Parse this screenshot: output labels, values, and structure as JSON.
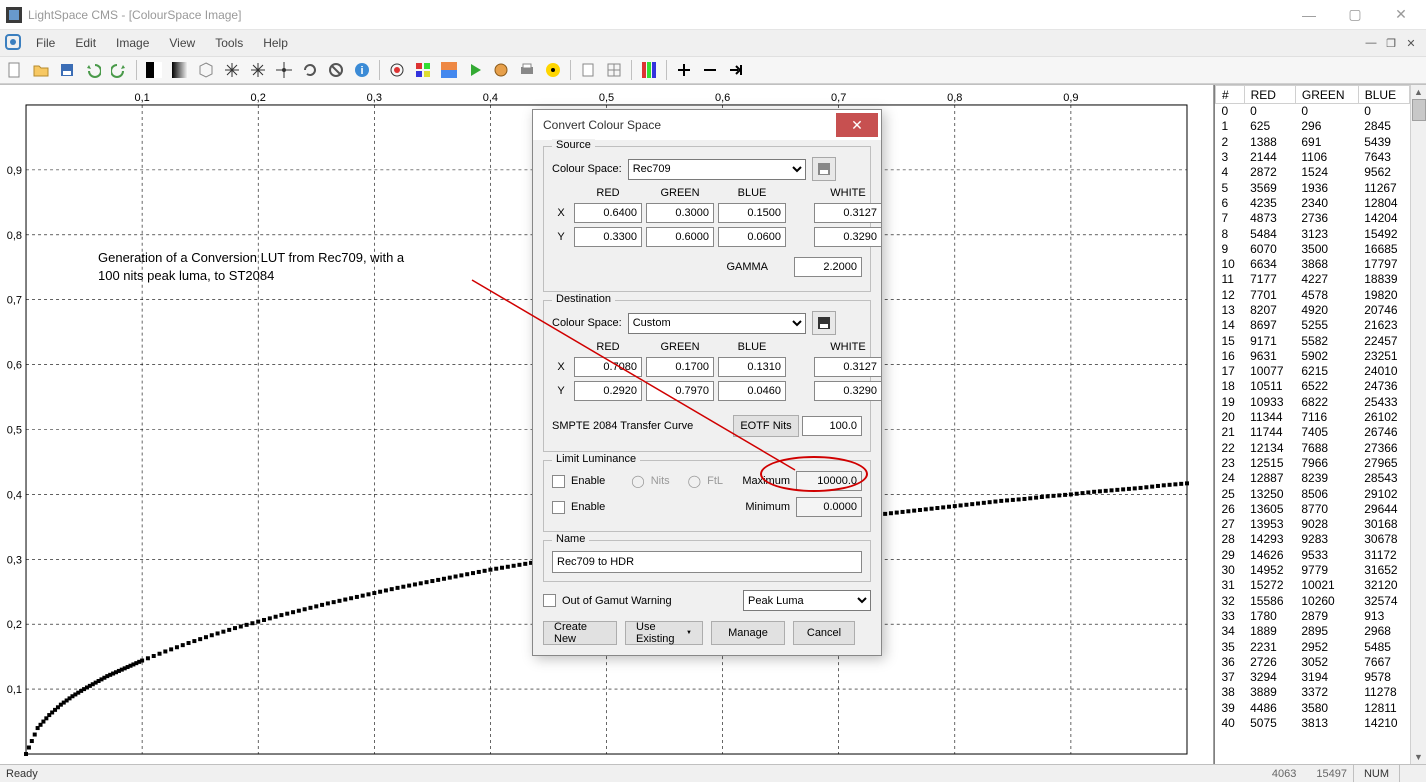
{
  "window": {
    "title": "LightSpace CMS - [ColourSpace Image]"
  },
  "menu": {
    "items": [
      "File",
      "Edit",
      "Image",
      "View",
      "Tools",
      "Help"
    ]
  },
  "statusbar": {
    "ready": "Ready",
    "footer_num": "4063",
    "footer_num2": "15497",
    "indicator": "NUM"
  },
  "dialog": {
    "title": "Convert Colour Space",
    "source_legend": "Source",
    "dest_legend": "Destination",
    "limit_legend": "Limit Luminance",
    "name_legend": "Name",
    "colour_space_label": "Colour Space:",
    "source_space": "Rec709",
    "dest_space": "Custom",
    "col_red": "RED",
    "col_green": "GREEN",
    "col_blue": "BLUE",
    "col_white": "WHITE",
    "row_x": "X",
    "row_y": "Y",
    "gamma_label": "GAMMA",
    "source": {
      "red_x": "0.6400",
      "green_x": "0.3000",
      "blue_x": "0.1500",
      "white_x": "0.3127",
      "red_y": "0.3300",
      "green_y": "0.6000",
      "blue_y": "0.0600",
      "white_y": "0.3290",
      "gamma": "2.2000"
    },
    "dest": {
      "red_x": "0.7080",
      "green_x": "0.1700",
      "blue_x": "0.1310",
      "white_x": "0.3127",
      "red_y": "0.2920",
      "green_y": "0.7970",
      "blue_y": "0.0460",
      "white_y": "0.3290"
    },
    "transfer_curve_label": "SMPTE 2084 Transfer Curve",
    "eotf_label": "EOTF Nits",
    "eotf_value": "100.0",
    "enable_label": "Enable",
    "nits_label": "Nits",
    "ftl_label": "FtL",
    "max_label": "Maximum",
    "min_label": "Minimum",
    "max_value": "10000.0",
    "min_value": "0.0000",
    "name_value": "Rec709 to HDR",
    "out_of_gamut_label": "Out of Gamut Warning",
    "gamut_select": "Peak Luma",
    "btn_create": "Create New",
    "btn_use_existing": "Use Existing",
    "btn_manage": "Manage",
    "btn_cancel": "Cancel"
  },
  "annotation": {
    "line1": "Generation of a Conversion LUT from Rec709, with a",
    "line2": "100 nits peak luma, to ST2084"
  },
  "axis_x": [
    "0,1",
    "0,2",
    "0,3",
    "0,4",
    "0,5",
    "0,6",
    "0,7",
    "0,8",
    "0,9"
  ],
  "axis_y": [
    "0,1",
    "0,2",
    "0,3",
    "0,4",
    "0,5",
    "0,6",
    "0,7",
    "0,8",
    "0,9"
  ],
  "data_table": {
    "headers": [
      "#",
      "RED",
      "GREEN",
      "BLUE"
    ],
    "rows": [
      [
        "0",
        "0",
        "0",
        "0"
      ],
      [
        "1",
        "625",
        "296",
        "2845"
      ],
      [
        "2",
        "1388",
        "691",
        "5439"
      ],
      [
        "3",
        "2144",
        "1106",
        "7643"
      ],
      [
        "4",
        "2872",
        "1524",
        "9562"
      ],
      [
        "5",
        "3569",
        "1936",
        "11267"
      ],
      [
        "6",
        "4235",
        "2340",
        "12804"
      ],
      [
        "7",
        "4873",
        "2736",
        "14204"
      ],
      [
        "8",
        "5484",
        "3123",
        "15492"
      ],
      [
        "9",
        "6070",
        "3500",
        "16685"
      ],
      [
        "10",
        "6634",
        "3868",
        "17797"
      ],
      [
        "11",
        "7177",
        "4227",
        "18839"
      ],
      [
        "12",
        "7701",
        "4578",
        "19820"
      ],
      [
        "13",
        "8207",
        "4920",
        "20746"
      ],
      [
        "14",
        "8697",
        "5255",
        "21623"
      ],
      [
        "15",
        "9171",
        "5582",
        "22457"
      ],
      [
        "16",
        "9631",
        "5902",
        "23251"
      ],
      [
        "17",
        "10077",
        "6215",
        "24010"
      ],
      [
        "18",
        "10511",
        "6522",
        "24736"
      ],
      [
        "19",
        "10933",
        "6822",
        "25433"
      ],
      [
        "20",
        "11344",
        "7116",
        "26102"
      ],
      [
        "21",
        "11744",
        "7405",
        "26746"
      ],
      [
        "22",
        "12134",
        "7688",
        "27366"
      ],
      [
        "23",
        "12515",
        "7966",
        "27965"
      ],
      [
        "24",
        "12887",
        "8239",
        "28543"
      ],
      [
        "25",
        "13250",
        "8506",
        "29102"
      ],
      [
        "26",
        "13605",
        "8770",
        "29644"
      ],
      [
        "27",
        "13953",
        "9028",
        "30168"
      ],
      [
        "28",
        "14293",
        "9283",
        "30678"
      ],
      [
        "29",
        "14626",
        "9533",
        "31172"
      ],
      [
        "30",
        "14952",
        "9779",
        "31652"
      ],
      [
        "31",
        "15272",
        "10021",
        "32120"
      ],
      [
        "32",
        "15586",
        "10260",
        "32574"
      ],
      [
        "33",
        "1780",
        "2879",
        "913"
      ],
      [
        "34",
        "1889",
        "2895",
        "2968"
      ],
      [
        "35",
        "2231",
        "2952",
        "5485"
      ],
      [
        "36",
        "2726",
        "3052",
        "7667"
      ],
      [
        "37",
        "3294",
        "3194",
        "9578"
      ],
      [
        "38",
        "3889",
        "3372",
        "11278"
      ],
      [
        "39",
        "4486",
        "3580",
        "12811"
      ],
      [
        "40",
        "5075",
        "3813",
        "14210"
      ]
    ]
  },
  "chart_data": {
    "type": "scatter",
    "title": "",
    "xlabel": "",
    "ylabel": "",
    "xlim": [
      0,
      1
    ],
    "ylim": [
      0,
      1
    ],
    "x_ticks": [
      0.1,
      0.2,
      0.3,
      0.4,
      0.5,
      0.6,
      0.7,
      0.8,
      0.9
    ],
    "y_ticks": [
      0.1,
      0.2,
      0.3,
      0.4,
      0.5,
      0.6,
      0.7,
      0.8,
      0.9
    ],
    "series": [
      {
        "name": "Transfer Curve",
        "points": [
          [
            0.0,
            0.0
          ],
          [
            0.01,
            0.04
          ],
          [
            0.02,
            0.06
          ],
          [
            0.03,
            0.076
          ],
          [
            0.04,
            0.089
          ],
          [
            0.05,
            0.1
          ],
          [
            0.06,
            0.11
          ],
          [
            0.07,
            0.12
          ],
          [
            0.08,
            0.128
          ],
          [
            0.09,
            0.136
          ],
          [
            0.1,
            0.144
          ],
          [
            0.12,
            0.158
          ],
          [
            0.14,
            0.171
          ],
          [
            0.16,
            0.183
          ],
          [
            0.18,
            0.194
          ],
          [
            0.2,
            0.204
          ],
          [
            0.22,
            0.214
          ],
          [
            0.24,
            0.223
          ],
          [
            0.26,
            0.232
          ],
          [
            0.28,
            0.24
          ],
          [
            0.3,
            0.248
          ],
          [
            0.32,
            0.256
          ],
          [
            0.34,
            0.263
          ],
          [
            0.36,
            0.27
          ],
          [
            0.38,
            0.277
          ],
          [
            0.4,
            0.284
          ],
          [
            0.42,
            0.29
          ],
          [
            0.44,
            0.296
          ],
          [
            0.46,
            0.302
          ],
          [
            0.48,
            0.308
          ],
          [
            0.5,
            0.313
          ],
          [
            0.52,
            0.319
          ],
          [
            0.54,
            0.324
          ],
          [
            0.56,
            0.329
          ],
          [
            0.58,
            0.334
          ],
          [
            0.6,
            0.339
          ],
          [
            0.62,
            0.344
          ],
          [
            0.64,
            0.349
          ],
          [
            0.66,
            0.353
          ],
          [
            0.68,
            0.358
          ],
          [
            0.7,
            0.362
          ],
          [
            0.72,
            0.366
          ],
          [
            0.74,
            0.37
          ],
          [
            0.76,
            0.374
          ],
          [
            0.78,
            0.378
          ],
          [
            0.8,
            0.382
          ],
          [
            0.82,
            0.386
          ],
          [
            0.84,
            0.39
          ],
          [
            0.86,
            0.393
          ],
          [
            0.88,
            0.397
          ],
          [
            0.9,
            0.4
          ],
          [
            0.92,
            0.404
          ],
          [
            0.94,
            0.407
          ],
          [
            0.96,
            0.41
          ],
          [
            0.98,
            0.414
          ],
          [
            1.0,
            0.417
          ]
        ]
      }
    ]
  }
}
